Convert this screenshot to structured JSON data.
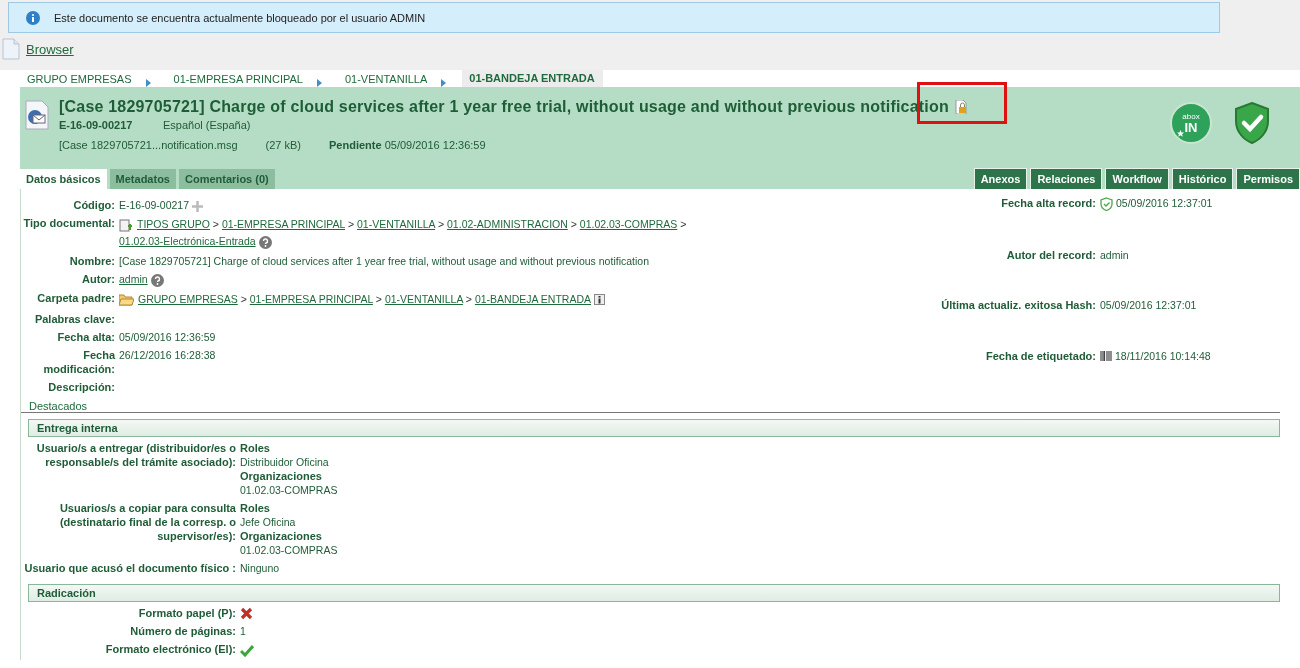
{
  "alert": {
    "text": "Este documento se encuentra actualmente bloqueado por el usuario ADMIN"
  },
  "browser_link": "Browser",
  "breadcrumb": [
    {
      "label": "GRUPO EMPRESAS",
      "selected": false
    },
    {
      "label": "01-EMPRESA PRINCIPAL",
      "selected": false
    },
    {
      "label": "01-VENTANILLA",
      "selected": false
    },
    {
      "label": "01-BANDEJA ENTRADA",
      "selected": true
    }
  ],
  "document": {
    "title": "[Case 1829705721] Charge of cloud services after 1 year free trial, without usage and without previous notification",
    "locked": true,
    "lock_highlighted": true,
    "code": "E-16-09-00217",
    "language": "Español (España)",
    "file": "[Case 1829705721...notification.msg",
    "size": "(27 kB)",
    "status": "Pendiente",
    "status_date": "05/09/2016 12:36:59",
    "badge_top": "abox",
    "badge_bottom": "IN"
  },
  "tabs": [
    {
      "label": "Datos básicos",
      "selected": true
    },
    {
      "label": "Metadatos",
      "selected": false
    },
    {
      "label": "Comentarios (0)",
      "selected": false
    }
  ],
  "actions": [
    "Anexos",
    "Relaciones",
    "Workflow",
    "Histórico",
    "Permisos"
  ],
  "fields_left": [
    {
      "label": "Código:",
      "kind": "code",
      "value": "E-16-09-00217"
    },
    {
      "label": "Tipo documental:",
      "kind": "doctype",
      "links": [
        "TIPOS GRUPO",
        "01-EMPRESA PRINCIPAL",
        "01-VENTANILLA",
        "01.02-ADMINISTRACION",
        "01.02.03-COMPRAS",
        "01.02.03-Electrónica-Entrada"
      ]
    },
    {
      "label": "Nombre:",
      "kind": "text",
      "value": "[Case 1829705721] Charge of cloud services after 1 year free trial, without usage and without previous notification"
    },
    {
      "label": "Autor:",
      "kind": "author",
      "links": [
        "admin"
      ]
    },
    {
      "label": "Carpeta padre:",
      "kind": "folder",
      "links": [
        "GRUPO EMPRESAS",
        "01-EMPRESA PRINCIPAL",
        "01-VENTANILLA",
        "01-BANDEJA ENTRADA"
      ]
    },
    {
      "label": "Palabras clave:",
      "kind": "text"
    },
    {
      "label": "Fecha alta:",
      "kind": "text",
      "value": "05/09/2016 12:36:59"
    },
    {
      "label": "Fecha modificación:",
      "kind": "text",
      "value": "26/12/2016 16:28:38"
    },
    {
      "label": "Descripción:",
      "kind": "text"
    }
  ],
  "fields_right": [
    {
      "label": "Fecha alta record:",
      "kind": "record",
      "value": "05/09/2016 12:37:01"
    },
    {
      "label": "Autor del record:",
      "kind": "text",
      "value": "admin"
    },
    {
      "label": "Última actualiz. exitosa Hash:",
      "kind": "text",
      "value": "05/09/2016 12:37:01"
    },
    {
      "label": "Fecha de etiquetado:",
      "kind": "barcode",
      "value": "18/11/2016 10:14:48"
    }
  ],
  "path_separator": ">",
  "highlights_link": "Destacados",
  "sections": [
    {
      "title": "Entrega interna",
      "rows": [
        {
          "label": "Usuario/s a entregar (distribuidor/es o responsable/s del trámite asociado):",
          "kind": "groups",
          "groups": [
            {
              "heading": "Roles",
              "value": "Distribuidor Oficina"
            },
            {
              "heading": "Organizaciones",
              "value": "01.02.03-COMPRAS"
            }
          ]
        },
        {
          "label": "Usuarios/s a copiar para consulta (destinatario final de la corresp. o supervisor/es):",
          "kind": "groups",
          "groups": [
            {
              "heading": "Roles",
              "value": "Jefe Oficina"
            },
            {
              "heading": "Organizaciones",
              "value": "01.02.03-COMPRAS"
            }
          ]
        },
        {
          "label": "Usuario que acusó el documento físico :",
          "kind": "text",
          "value": "Ninguno"
        }
      ]
    },
    {
      "title": "Radicación",
      "rows": [
        {
          "label": "Formato papel (P):",
          "kind": "bool",
          "checked": false
        },
        {
          "label": "Número de páginas:",
          "kind": "text",
          "value": "1"
        },
        {
          "label": "Formato electrónico (El):",
          "kind": "bool",
          "checked": true
        }
      ]
    }
  ]
}
